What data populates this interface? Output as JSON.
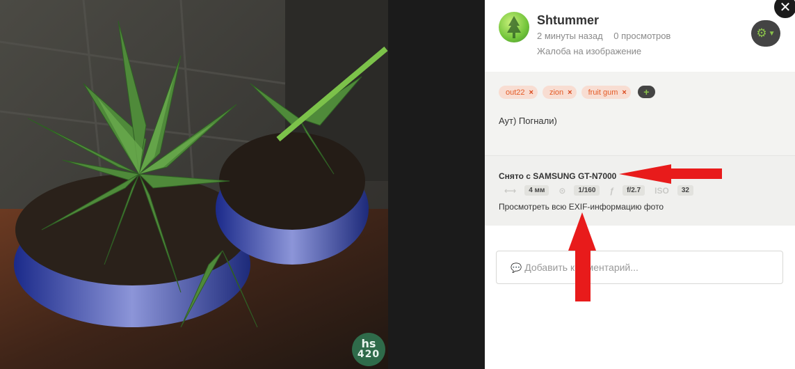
{
  "post": {
    "author": "Shtummer",
    "time_ago": "2 минуты назад",
    "views": "0 просмотров",
    "report_link": "Жалоба на изображение",
    "description": "Аут) Погнали)"
  },
  "tags": [
    {
      "label": "out22"
    },
    {
      "label": "zion"
    },
    {
      "label": "fruit gum"
    }
  ],
  "tag_remove_glyph": "×",
  "tag_add_glyph": "+",
  "exif": {
    "title": "Снято с SAMSUNG GT-N7000",
    "items": [
      {
        "icon": "focal-length-icon",
        "glyph": "⟷",
        "value": "4 мм"
      },
      {
        "icon": "shutter-icon",
        "glyph": "⊙",
        "value": "1/160"
      },
      {
        "icon": "aperture-icon",
        "glyph": "ƒ",
        "value": "f/2.7"
      },
      {
        "icon": "iso-icon",
        "glyph": "ISO",
        "value": "32"
      }
    ],
    "full_link": "Просмотреть всю EXIF-информацию фото"
  },
  "comment": {
    "placeholder": "Добавить комментарий..."
  },
  "watermark": {
    "line1": "hs",
    "line2": "420"
  },
  "colors": {
    "accent_green": "#8bc34a",
    "tag_text": "#e35b26",
    "tag_bg": "#f8ddd2",
    "annotation_arrow": "#e81b1b"
  }
}
